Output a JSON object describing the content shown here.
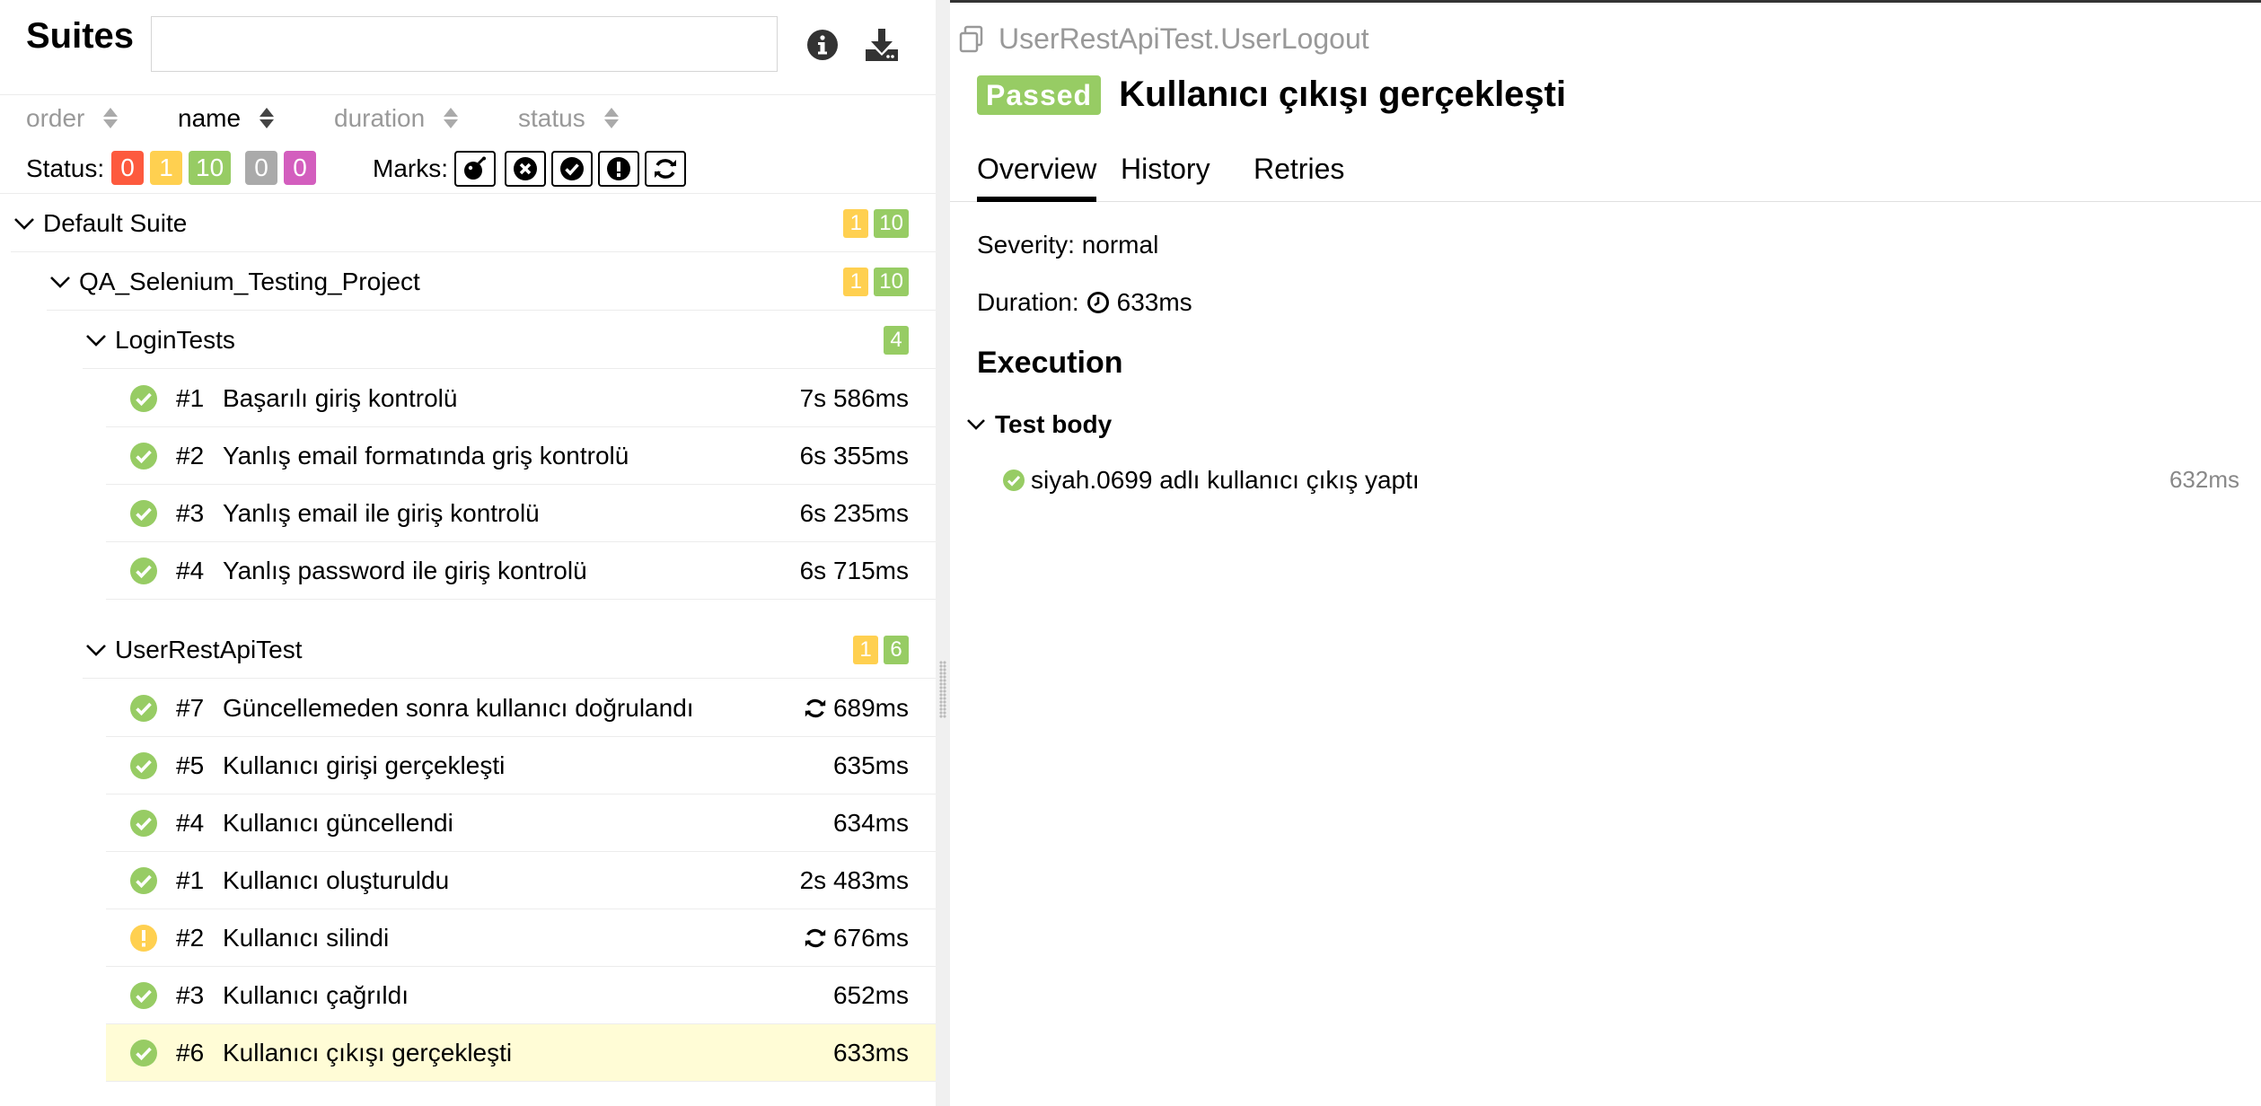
{
  "left": {
    "title": "Suites",
    "search": {
      "value": "",
      "placeholder": ""
    },
    "icons": {
      "info": "info-icon",
      "download": "download-icon"
    },
    "sort": [
      {
        "label": "order",
        "active": false
      },
      {
        "label": "name",
        "active": true
      },
      {
        "label": "duration",
        "active": false
      },
      {
        "label": "status",
        "active": false
      }
    ],
    "filters": {
      "status_label": "Status:",
      "status_counts": {
        "failed": "0",
        "broken": "1",
        "passed": "10",
        "skipped": "0",
        "unknown": "0"
      },
      "marks_label": "Marks:",
      "marks": [
        "flaky-bomb-icon",
        "new-failed-icon",
        "new-passed-icon",
        "new-broken-icon",
        "retries-icon"
      ]
    },
    "tree": {
      "default_suite": {
        "name": "Default Suite",
        "broken": "1",
        "passed": "10"
      },
      "project": {
        "name": "QA_Selenium_Testing_Project",
        "broken": "1",
        "passed": "10"
      },
      "login_tests": {
        "name": "LoginTests",
        "passed": "4",
        "items": [
          {
            "num": "#1",
            "name": "Başarılı giriş kontrolü",
            "duration": "7s 586ms",
            "status": "passed",
            "retry": false
          },
          {
            "num": "#2",
            "name": "Yanlış email formatında griş kontrolü",
            "duration": "6s 355ms",
            "status": "passed",
            "retry": false
          },
          {
            "num": "#3",
            "name": "Yanlış email ile giriş kontrolü",
            "duration": "6s 235ms",
            "status": "passed",
            "retry": false
          },
          {
            "num": "#4",
            "name": "Yanlış password ile giriş kontrolü",
            "duration": "6s 715ms",
            "status": "passed",
            "retry": false
          }
        ]
      },
      "user_rest": {
        "name": "UserRestApiTest",
        "broken": "1",
        "passed": "6",
        "items": [
          {
            "num": "#7",
            "name": "Güncellemeden sonra kullanıcı doğrulandı",
            "duration": "689ms",
            "status": "passed",
            "retry": true
          },
          {
            "num": "#5",
            "name": "Kullanıcı girişi gerçekleşti",
            "duration": "635ms",
            "status": "passed",
            "retry": false
          },
          {
            "num": "#4",
            "name": "Kullanıcı güncellendi",
            "duration": "634ms",
            "status": "passed",
            "retry": false
          },
          {
            "num": "#1",
            "name": "Kullanıcı oluşturuldu",
            "duration": "2s 483ms",
            "status": "passed",
            "retry": false
          },
          {
            "num": "#2",
            "name": "Kullanıcı silindi",
            "duration": "676ms",
            "status": "broken",
            "retry": true
          },
          {
            "num": "#3",
            "name": "Kullanıcı çağrıldı",
            "duration": "652ms",
            "status": "passed",
            "retry": false
          },
          {
            "num": "#6",
            "name": "Kullanıcı çıkışı gerçekleşti",
            "duration": "633ms",
            "status": "passed",
            "retry": false,
            "selected": true
          }
        ]
      }
    }
  },
  "right": {
    "breadcrumb": "UserRestApiTest.UserLogout",
    "status_badge": "Passed",
    "title": "Kullanıcı çıkışı gerçekleşti",
    "tabs": [
      "Overview",
      "History",
      "Retries"
    ],
    "active_tab": "Overview",
    "severity": "Severity: normal",
    "duration_label": "Duration:",
    "duration_value": "633ms",
    "execution_title": "Execution",
    "test_body": {
      "label": "Test body",
      "step": "siyah.0699 adlı kullanıcı çıkış yaptı",
      "step_duration": "632ms"
    }
  },
  "colors": {
    "passed": "#97cc64",
    "broken": "#ffd050",
    "failed": "#fd5a3e",
    "skipped": "#aaaaaa",
    "unknown": "#d35ebe",
    "selected_row": "#fffcd6"
  }
}
